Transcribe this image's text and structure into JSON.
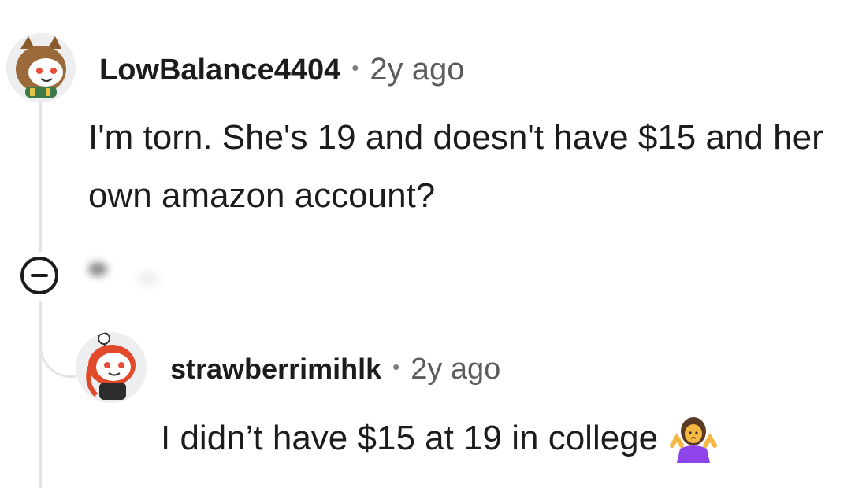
{
  "thread": {
    "parent_comment": {
      "username": "LowBalance4404",
      "separator": "•",
      "timestamp": "2y ago",
      "body": "I'm torn. She's 19 and doesn't have $15 and her own amazon account?",
      "avatar_icon": "owl-snoo-avatar"
    },
    "collapse_icon": "minus-circle-icon",
    "reply_comment": {
      "username": "strawberrimihlk",
      "separator": "•",
      "timestamp": "2y ago",
      "body": "I didn’t have $15 at 19 in college",
      "emoji_icon": "person-shrugging-emoji",
      "avatar_icon": "red-hair-snoo-avatar"
    }
  },
  "colors": {
    "text": "#1c1c1c",
    "meta": "#5c5c5c",
    "thread_line": "#e3e3e3",
    "emoji_shirt": "#8e44e8"
  }
}
